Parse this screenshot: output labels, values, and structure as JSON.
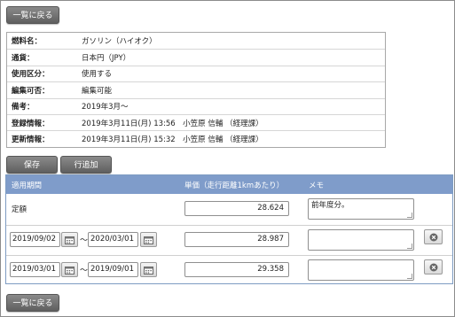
{
  "nav": {
    "back_label": "一覧に戻る"
  },
  "info": {
    "rows": [
      {
        "label": "燃料名：",
        "value": "ガソリン（ハイオク）"
      },
      {
        "label": "通貨：",
        "value": "日本円（JPY）"
      },
      {
        "label": "使用区分：",
        "value": "使用する"
      },
      {
        "label": "編集可否：",
        "value": "編集可能"
      },
      {
        "label": "備考：",
        "value": "2019年3月～"
      },
      {
        "label": "登録情報：",
        "value": "2019年3月11日(月) 13:56　小笠原 信輔 （経理課）"
      },
      {
        "label": "更新情報：",
        "value": "2019年3月11日(月) 15:32　小笠原 信輔 （経理課）"
      }
    ]
  },
  "toolbar": {
    "save_label": "保存",
    "add_row_label": "行追加"
  },
  "rates": {
    "headers": {
      "period": "適用期間",
      "unit_price": "単価（走行距離1kmあたり）",
      "memo": "メモ"
    },
    "fixed_row": {
      "label": "定額",
      "amount": "28.624",
      "memo": "前年度分。"
    },
    "rows": [
      {
        "start": "2019/09/02",
        "end": "2020/03/01",
        "amount": "28.987",
        "memo": ""
      },
      {
        "start": "2019/03/01",
        "end": "2019/09/01",
        "amount": "29.358",
        "memo": ""
      }
    ],
    "tilde": "～"
  },
  "colors": {
    "header_bg": "#7f9cca",
    "button_bg": "#6f6f6f"
  },
  "icons": {
    "calendar": "calendar-icon",
    "delete": "delete-circle-x-icon"
  }
}
